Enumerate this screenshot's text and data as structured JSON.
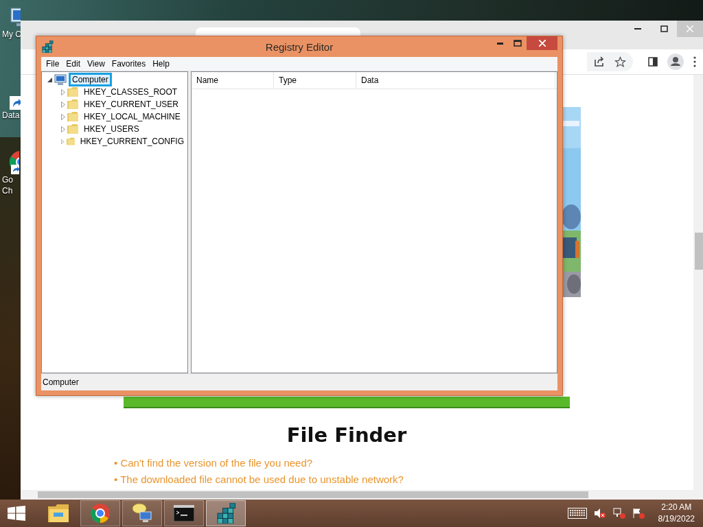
{
  "desktop_icons": [
    {
      "kind": "computer",
      "lines": [
        "My C"
      ]
    },
    {
      "kind": "shortcut",
      "lines": [
        "Data"
      ]
    },
    {
      "kind": "chrome",
      "lines": [
        "Go",
        "Ch"
      ]
    }
  ],
  "browser": {
    "content": {
      "heading": "File Finder",
      "bullets": [
        "• Can't find the version of the file you need?",
        "• The downloaded file cannot be used due to unstable network?"
      ]
    }
  },
  "registry_editor": {
    "title": "Registry Editor",
    "menu": [
      "File",
      "Edit",
      "View",
      "Favorites",
      "Help"
    ],
    "tree": {
      "label": "Computer",
      "expanded": true,
      "selected": true,
      "children": [
        {
          "label": "HKEY_CLASSES_ROOT",
          "expanded": false,
          "selected": false
        },
        {
          "label": "HKEY_CURRENT_USER",
          "expanded": false,
          "selected": false
        },
        {
          "label": "HKEY_LOCAL_MACHINE",
          "expanded": false,
          "selected": false
        },
        {
          "label": "HKEY_USERS",
          "expanded": false,
          "selected": false
        },
        {
          "label": "HKEY_CURRENT_CONFIG",
          "expanded": false,
          "selected": false
        }
      ]
    },
    "columns": [
      "Name",
      "Type",
      "Data"
    ],
    "status": "Computer"
  },
  "taskbar": {
    "apps": [
      {
        "kind": "explorer",
        "running": false,
        "selected": false
      },
      {
        "kind": "chrome",
        "running": true,
        "selected": false
      },
      {
        "kind": "chat",
        "running": true,
        "selected": false
      },
      {
        "kind": "console",
        "running": true,
        "selected": false
      },
      {
        "kind": "registry",
        "running": true,
        "selected": true
      }
    ],
    "clock": {
      "time": "2:20 AM",
      "date": "8/19/2022"
    }
  }
}
